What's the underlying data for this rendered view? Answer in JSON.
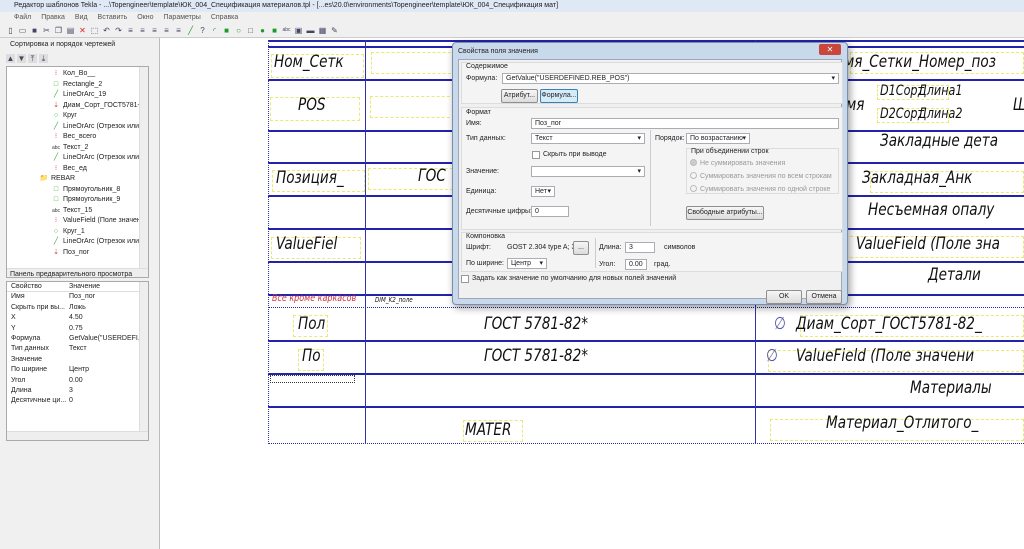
{
  "window": {
    "title": "Редактор шаблонов Tekla - ...\\Topengineer\\template\\ЮК_004_Спецификация материалов.tpl  - [...es\\20.0\\environments\\Topengineer\\template\\ЮК_004_Спецификация мат]"
  },
  "menu": [
    "Файл",
    "Правка",
    "Вид",
    "Вставить",
    "Окно",
    "Параметры",
    "Справка"
  ],
  "toolbar_icons": [
    "new",
    "open",
    "save",
    "cut",
    "copy",
    "paste",
    "delete",
    "select",
    "undo",
    "redo",
    "align-top",
    "align-center",
    "align-middle",
    "align-bottom",
    "align-base",
    "line",
    "polyline",
    "arc",
    "filled-rect",
    "circle",
    "rectangle",
    "filled-circle",
    "filled-square",
    "text-abc",
    "field",
    "image",
    "value-field",
    "edit"
  ],
  "sorting_panel": {
    "title": "Сортировка и порядок чертежей",
    "tree": [
      {
        "icon": "value-field",
        "label": "Кол_Во__"
      },
      {
        "icon": "rectangle",
        "label": "Rectangle_2"
      },
      {
        "icon": "line",
        "label": "LineOrArc_19"
      },
      {
        "icon": "value-field-sort",
        "label": "Диам_Сорт_ГОСТ5781-8"
      },
      {
        "icon": "circle",
        "label": "Круг"
      },
      {
        "icon": "line",
        "label": "LineOrArc (Отрезок или"
      },
      {
        "icon": "value-field",
        "label": "Вес_всего"
      },
      {
        "icon": "text",
        "label": "Текст_2"
      },
      {
        "icon": "line",
        "label": "LineOrArc (Отрезок или"
      },
      {
        "icon": "value-field",
        "label": "Вес_ед"
      },
      {
        "icon": "folder",
        "label": "REBAR"
      },
      {
        "icon": "rectangle",
        "label": "Прямоугольник_8"
      },
      {
        "icon": "rectangle",
        "label": "Прямоугольник_9"
      },
      {
        "icon": "text",
        "label": "Текст_15"
      },
      {
        "icon": "value-field",
        "label": "ValueField (Поле значен"
      },
      {
        "icon": "circle",
        "label": "Круг_1"
      },
      {
        "icon": "line",
        "label": "LineOrArc (Отрезок или"
      },
      {
        "icon": "value-field-sort",
        "label": "Поз_пог"
      }
    ]
  },
  "preview_panel": {
    "title": "Панель предварительного просмотра",
    "col_property": "Свойство",
    "col_value": "Значение",
    "rows": [
      [
        "Имя",
        "Поз_пог"
      ],
      [
        "Скрыть при вы...",
        "Ложь"
      ],
      [
        "X",
        "4.50"
      ],
      [
        "Y",
        "0.75"
      ],
      [
        "Формула",
        "GetValue(\"USERDEFI..."
      ],
      [
        "Тип данных",
        "Текст"
      ],
      [
        "Значение",
        ""
      ],
      [
        "По ширине",
        "Центр"
      ],
      [
        "Угол",
        "0.00"
      ],
      [
        "Длина",
        "3"
      ],
      [
        "Десятичные ци...",
        "0"
      ]
    ]
  },
  "canvas": {
    "cells": [
      "Ном_Сетк",
      "POS",
      "Позиция_",
      "ГОС",
      "ValueFiel",
      "Все кроме каркасов",
      "DIM_K2_поле",
      "Пол",
      "По",
      "ГОСТ 5781-82*",
      "ГОСТ 5781-82*",
      "MATER",
      "мя_Сетки_Номер_поз",
      "мя",
      "D1Сорт",
      "Длина1",
      "D2Сорт",
      "Длина2",
      "Ш",
      "Закладные дета",
      "Закладная_Анк",
      "Несъемная опалу",
      "ValueField (Поле зна",
      "Детали",
      "Диам_Сорт_ГОСТ5781-82_",
      "ValueField (Поле значени",
      "Материалы",
      "Материал_Отлитого_"
    ]
  },
  "dialog": {
    "title": "Свойства поля значения",
    "content_group": "Содержимое",
    "formula_label": "Формула:",
    "formula_value": "GetValue(\"USERDEFINED.REB_POS\")",
    "attribute_btn": "Атрибут...",
    "formula_btn": "Формула...",
    "format_group": "Формат",
    "name_label": "Имя:",
    "name_value": "Поз_пог",
    "datatype_label": "Тип данных:",
    "datatype_value": "Текст",
    "hide_label": "Скрыть при выводе",
    "value_label": "Значение:",
    "value_value": "",
    "unit_label": "Единица:",
    "unit_value": "Нет",
    "decimals_label": "Десятичные цифры:",
    "decimals_value": "0",
    "order_label": "Порядок:",
    "order_value": "По возрастанию",
    "merge_group": "При объединении строк",
    "merge_options": [
      "Не суммировать значения",
      "Суммировать значения по всем строкам",
      "Суммировать значения по одной строке"
    ],
    "free_attrs_btn": "Свободные атрибуты...",
    "layout_group": "Компоновка",
    "font_label": "Шрифт:",
    "font_value": "GOST 2.304 type A; 3",
    "font_btn": "...",
    "justify_label": "По ширине:",
    "justify_value": "Центр",
    "length_label": "Длина:",
    "length_value": "3",
    "length_unit": "символов",
    "angle_label": "Угол:",
    "angle_value": "0.00",
    "angle_unit": "град.",
    "default_label": "Задать как значение по умолчанию для новых полей значений",
    "ok": "OK",
    "cancel": "Отмена"
  },
  "colors": {
    "table_line": "#2222aa",
    "field_box": "#eaea70",
    "red_text": "#cc3344"
  }
}
